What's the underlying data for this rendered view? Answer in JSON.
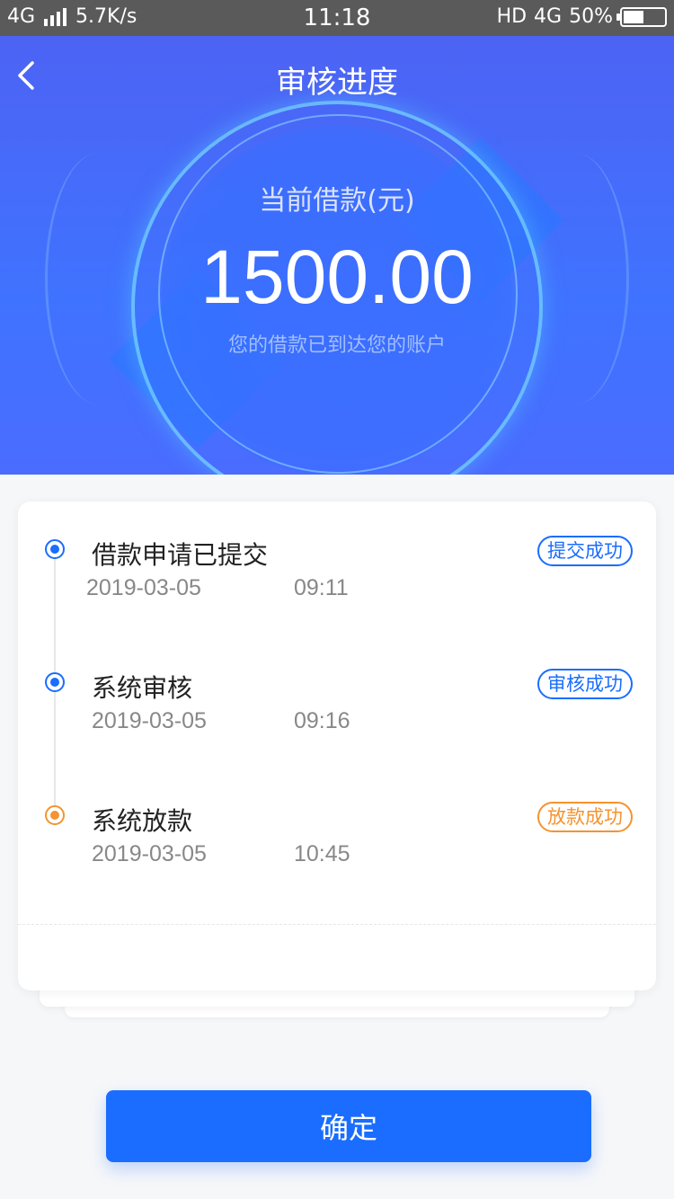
{
  "status_bar": {
    "network": "4G",
    "speed": "5.7K/s",
    "time": "11:18",
    "hd": "HD",
    "network_right": "4G",
    "battery": "50%",
    "battery_level": 0.5
  },
  "header": {
    "title": "审核进度",
    "back_icon": "chevron-left-icon"
  },
  "loan": {
    "label": "当前借款(元)",
    "amount": "1500.00",
    "note": "您的借款已到达您的账户"
  },
  "steps": [
    {
      "title": "借款申请已提交",
      "date": "2019-03-05",
      "time": "09:11",
      "badge": "提交成功",
      "color": "#1a6dff"
    },
    {
      "title": "系统审核",
      "date": "2019-03-05",
      "time": "09:16",
      "badge": "审核成功",
      "color": "#1a6dff"
    },
    {
      "title": "系统放款",
      "date": "2019-03-05",
      "time": "10:45",
      "badge": "放款成功",
      "color": "#f5932f"
    }
  ],
  "confirm_button": {
    "label": "确定"
  },
  "colors": {
    "primary": "#1a6dff",
    "accent_orange": "#f5932f"
  }
}
